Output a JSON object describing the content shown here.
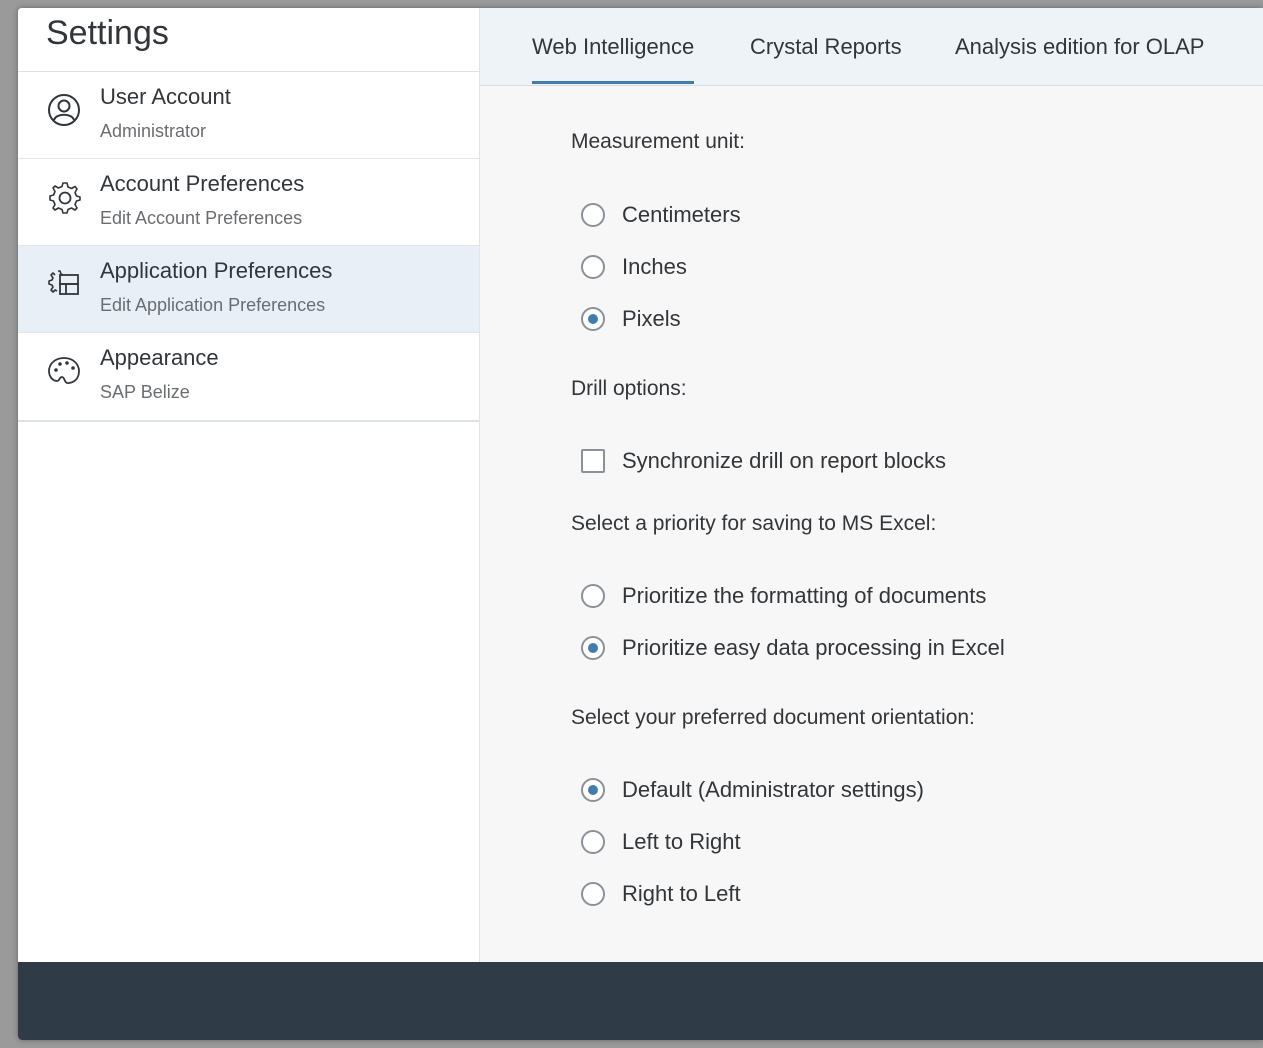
{
  "settings": {
    "title": "Settings",
    "nav_items": [
      {
        "title": "User Account",
        "subtitle": "Administrator",
        "icon": "user-icon",
        "selected": false
      },
      {
        "title": "Account Preferences",
        "subtitle": "Edit Account Preferences",
        "icon": "gear-icon",
        "selected": false
      },
      {
        "title": "Application Preferences",
        "subtitle": "Edit Application Preferences",
        "icon": "app-settings-icon",
        "selected": true
      },
      {
        "title": "Appearance",
        "subtitle": "SAP Belize",
        "icon": "palette-icon",
        "selected": false
      }
    ]
  },
  "tabs": [
    {
      "label": "Web Intelligence",
      "active": true
    },
    {
      "label": "Crystal Reports",
      "active": false
    },
    {
      "label": "Analysis edition for OLAP",
      "active": false
    }
  ],
  "web_intelligence": {
    "measurement": {
      "label": "Measurement unit:",
      "options": [
        {
          "label": "Centimeters",
          "checked": false
        },
        {
          "label": "Inches",
          "checked": false
        },
        {
          "label": "Pixels",
          "checked": true
        }
      ]
    },
    "drill": {
      "label": "Drill options:",
      "sync_label": "Synchronize drill on report blocks",
      "sync_checked": false
    },
    "excel": {
      "label": "Select a priority for saving to MS Excel:",
      "options": [
        {
          "label": "Prioritize the formatting of documents",
          "checked": false
        },
        {
          "label": "Prioritize easy data processing in Excel",
          "checked": true
        }
      ]
    },
    "orientation": {
      "label": "Select your preferred document orientation:",
      "options": [
        {
          "label": "Default (Administrator settings)",
          "checked": true
        },
        {
          "label": "Left to Right",
          "checked": false
        },
        {
          "label": "Right to Left",
          "checked": false
        }
      ]
    }
  },
  "colors": {
    "accent": "#427cac",
    "selected_bg": "#e8eff6",
    "footer": "#2f3c48",
    "text": "#32363a"
  }
}
